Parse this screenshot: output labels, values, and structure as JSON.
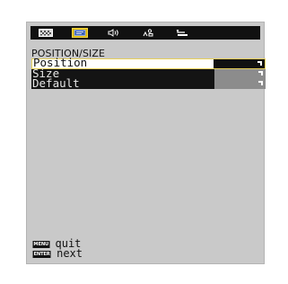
{
  "tabs": [
    {
      "icon": "picture-icon",
      "active": false
    },
    {
      "icon": "screen-position-icon",
      "active": true
    },
    {
      "icon": "audio-icon",
      "active": false
    },
    {
      "icon": "setup-icon",
      "active": false
    },
    {
      "icon": "return-icon",
      "active": false
    }
  ],
  "menu": {
    "title": "POSITION/SIZE",
    "items": [
      {
        "label": "Position",
        "selected": true
      },
      {
        "label": "Size",
        "selected": false
      },
      {
        "label": "Default",
        "selected": false
      }
    ]
  },
  "hints": [
    {
      "key": "MENU",
      "action": "quit"
    },
    {
      "key": "ENTER",
      "action": "next"
    }
  ],
  "colors": {
    "panel": "#c9c9c9",
    "tab_bar": "#111111",
    "selected_row": "#ffffff",
    "selected_outline": "#e8d05a",
    "row_dark": "#141414",
    "value_box": "#8c8c8c"
  }
}
